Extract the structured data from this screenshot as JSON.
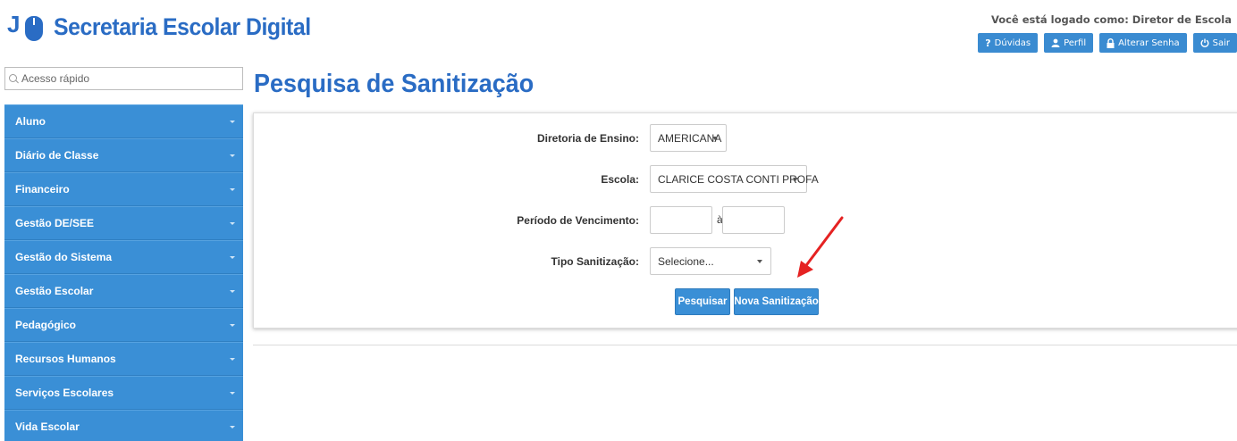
{
  "header": {
    "app_title": "Secretaria Escolar Digital",
    "logo_glyph": "J",
    "logo_tick": "̓",
    "logged_as": "Você está logado como: Diretor de Escola",
    "buttons": [
      {
        "icon": "?",
        "label": "Dúvidas"
      },
      {
        "icon": "user-icon",
        "label": "Perfil"
      },
      {
        "icon": "lock-icon",
        "label": "Alterar Senha"
      },
      {
        "icon": "power-icon",
        "label": "Sair"
      }
    ]
  },
  "sidebar": {
    "quick_access_placeholder": "Acesso rápido",
    "items": [
      {
        "label": "Aluno"
      },
      {
        "label": "Diário de Classe"
      },
      {
        "label": "Financeiro"
      },
      {
        "label": "Gestão DE/SEE"
      },
      {
        "label": "Gestão do Sistema"
      },
      {
        "label": "Gestão Escolar"
      },
      {
        "label": "Pedagógico"
      },
      {
        "label": "Recursos Humanos"
      },
      {
        "label": "Serviços Escolares"
      },
      {
        "label": "Vida Escolar"
      }
    ]
  },
  "main": {
    "page_title": "Pesquisa de Sanitização",
    "form": {
      "diretoria_label": "Diretoria de Ensino:",
      "diretoria_value": "AMERICANA",
      "escola_label": "Escola:",
      "escola_value": "CLARICE COSTA CONTI PROFA",
      "periodo_label": "Período de Vencimento:",
      "periodo_separator": "à",
      "tipo_label": "Tipo Sanitização:",
      "tipo_value": "Selecione..."
    },
    "buttons": {
      "search": "Pesquisar",
      "new": "Nova Sanitização"
    }
  },
  "colors": {
    "brand": "#2a6cc4",
    "menu": "#3a8fd6",
    "annotation_arrow": "#e52222"
  }
}
